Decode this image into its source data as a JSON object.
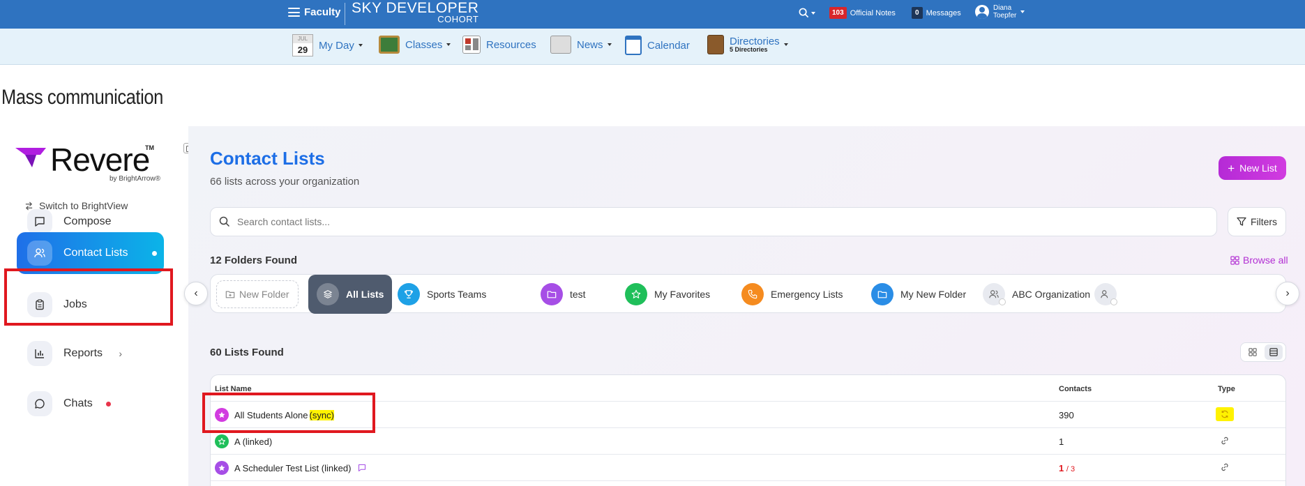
{
  "topbar": {
    "faculty_label": "Faculty",
    "brand_top": "SKY DEVELOPER",
    "brand_bottom": "COHORT",
    "notes_count": "103",
    "notes_label": "Official Notes",
    "messages_count": "0",
    "messages_label": "Messages",
    "user_first": "Diana",
    "user_last": "Toepfer"
  },
  "navbar": {
    "calendar_month": "JUL",
    "calendar_day": "29",
    "items": [
      {
        "label": "My Day"
      },
      {
        "label": "Classes"
      },
      {
        "label": "Resources"
      },
      {
        "label": "News"
      },
      {
        "label": "Calendar"
      },
      {
        "label": "Directories",
        "sub": "5 Directories"
      }
    ]
  },
  "page_title": "Mass communication",
  "sidebar": {
    "logo_text": "Revere",
    "logo_tm": "TM",
    "logo_sub": "by BrightArrow®",
    "switch_label": "Switch to BrightView",
    "items": [
      {
        "label": "Compose"
      },
      {
        "label": "Contact Lists"
      },
      {
        "label": "Jobs"
      },
      {
        "label": "Reports"
      },
      {
        "label": "Chats"
      }
    ]
  },
  "main": {
    "title": "Contact Lists",
    "subtitle": "66 lists across your organization",
    "new_list_label": "New List",
    "search_placeholder": "Search contact lists...",
    "filters_label": "Filters",
    "folders_found": "12 Folders Found",
    "browse_all": "Browse all",
    "folders": [
      {
        "label": "New Folder"
      },
      {
        "label": "All Lists"
      },
      {
        "label": "Sports Teams",
        "color": "#1ea1e6"
      },
      {
        "label": "test",
        "color": "#a64ee6"
      },
      {
        "label": "My Favorites",
        "color": "#1fbf5a"
      },
      {
        "label": "Emergency Lists",
        "color": "#f58b1f"
      },
      {
        "label": "My New Folder",
        "color": "#2a8de6"
      },
      {
        "label": "ABC Organization",
        "color": "#e8eaf0"
      }
    ],
    "lists_found": "60 Lists Found",
    "table": {
      "headers": {
        "name": "List Name",
        "contacts": "Contacts",
        "type": "Type"
      },
      "rows": [
        {
          "name": "All Students Alone",
          "suffix": "(sync)",
          "contacts": "390",
          "type": "sync"
        },
        {
          "name": "A (linked)",
          "contacts": "1",
          "type": "linked"
        },
        {
          "name": "A Scheduler Test List (linked)",
          "contacts": "1",
          "contacts_total": "/ 3",
          "type": "linked"
        }
      ]
    }
  },
  "colors": {
    "topbar": "#2f73c0",
    "accent_blue": "#1d6ee6",
    "accent_purple": "#c234dc",
    "annotation_red": "#e0181f",
    "highlight_yellow": "#fff200"
  }
}
